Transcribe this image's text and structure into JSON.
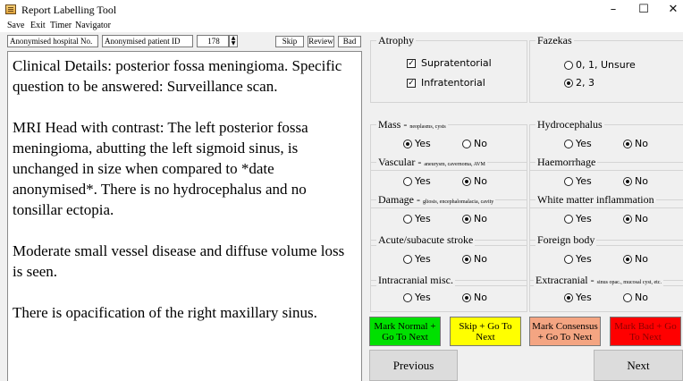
{
  "window": {
    "title": "Report Labelling Tool",
    "controls": {
      "minimize": "–",
      "maximize": "☐",
      "close": "✕"
    }
  },
  "menu": {
    "items": [
      "Save",
      "Exit",
      "Timer",
      "Navigator"
    ]
  },
  "header": {
    "hospital_no": "Anonymised  hospital  No.",
    "patient_id": "Anonymised patient ID",
    "counter": "178",
    "spin_up": "▲",
    "spin_down": "▼",
    "skip": "Skip",
    "review": "Review",
    "bad": "Bad"
  },
  "report": {
    "paragraphs": [
      "Clinical Details: posterior fossa meningioma. Specific question to be answered: Surveillance scan.",
      "MRI Head with contrast: The left posterior fossa meningioma, abutting the left sigmoid sinus, is unchanged in size when compared to *date anonymised*. There is no hydrocephalus and no tonsillar ectopia.",
      "Moderate small vessel disease and diffuse volume loss is seen.",
      "There is opacification of the right maxillary sinus."
    ]
  },
  "groups": {
    "atrophy": {
      "label": "Atrophy",
      "options": [
        "Supratentorial",
        "Infratentorial"
      ],
      "checked": [
        true,
        true
      ],
      "check_mark": "☑"
    },
    "fazekas": {
      "label": "Fazekas",
      "options": [
        "0, 1, Unsure",
        "2, 3"
      ],
      "selected": 1
    },
    "mass": {
      "label": "Mass - ",
      "sub": "neoplasms, cysts",
      "yes": "Yes",
      "no": "No",
      "selected": "yes"
    },
    "hydrocephalus": {
      "label": "Hydrocephalus",
      "yes": "Yes",
      "no": "No",
      "selected": "no"
    },
    "vascular": {
      "label": "Vascular - ",
      "sub": "aneurysm, cavernoma, AVM",
      "yes": "Yes",
      "no": "No",
      "selected": "no"
    },
    "haemorrhage": {
      "label": "Haemorrhage",
      "yes": "Yes",
      "no": "No",
      "selected": "no"
    },
    "damage": {
      "label": "Damage - ",
      "sub": "gliosis, encephalomalacia, cavity",
      "yes": "Yes",
      "no": "No",
      "selected": "no"
    },
    "wm_inflammation": {
      "label": "White matter inflammation",
      "yes": "Yes",
      "no": "No",
      "selected": "no"
    },
    "stroke": {
      "label": "Acute/subacute stroke",
      "yes": "Yes",
      "no": "No",
      "selected": "no"
    },
    "foreign_body": {
      "label": "Foreign body",
      "yes": "Yes",
      "no": "No",
      "selected": "no"
    },
    "intracranial_misc": {
      "label": "Intracranial misc.",
      "yes": "Yes",
      "no": "No",
      "selected": "no"
    },
    "extracranial": {
      "label": "Extracranial - ",
      "sub": "sinus opac., mucosal cyst, etc.",
      "yes": "Yes",
      "no": "No",
      "selected": "yes"
    }
  },
  "actions": {
    "mark_normal": {
      "label": "Mark Normal + Go To Next",
      "color": "#00e000",
      "text_color": "#000000"
    },
    "skip_next": {
      "label": "Skip + Go To Next",
      "color": "#ffff00",
      "text_color": "#000000"
    },
    "mark_consensus": {
      "label": "Mark Consensus + Go To Next",
      "color": "#f4a582",
      "text_color": "#000000"
    },
    "mark_bad": {
      "label": "Mark Bad + Go To Next",
      "color": "#ff0000",
      "text_color": "#8b0000"
    }
  },
  "nav": {
    "previous": "Previous",
    "next": "Next"
  }
}
